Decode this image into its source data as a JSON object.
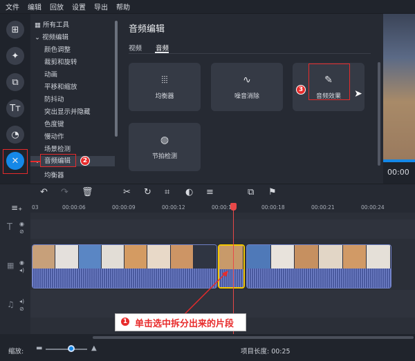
{
  "menu": [
    "文件",
    "编辑",
    "回放",
    "设置",
    "导出",
    "帮助"
  ],
  "tree": {
    "head": "所有工具",
    "group": "视频编辑",
    "items": [
      "颜色调整",
      "裁剪和旋转",
      "动画",
      "平移和缩放",
      "防抖动",
      "突出显示并隐藏",
      "色度键",
      "慢动作",
      "场景检测"
    ],
    "selected": "音频编辑",
    "after": "均衡器"
  },
  "panel": {
    "title": "音频编辑",
    "tabs": [
      "视频",
      "音频"
    ],
    "cards": [
      {
        "label": "均衡器",
        "icon": "equalizer-icon"
      },
      {
        "label": "噪音消除",
        "icon": "noise-removal-icon"
      },
      {
        "label": "音频效果",
        "icon": "audio-effects-icon"
      },
      {
        "label": "节拍检测",
        "icon": "beat-detection-icon"
      }
    ]
  },
  "preview": {
    "time": "00:00"
  },
  "ruler": [
    "03",
    "00:00:06",
    "00:00:09",
    "00:00:12",
    "00:00:1",
    "00:00:18",
    "00:00:21",
    "00:00:24"
  ],
  "status": {
    "zoom_label": "缩放:",
    "project_length": "项目长度: 00:25"
  },
  "annotations": {
    "a1": "单击选中拆分出来的片段",
    "n1": "1",
    "n2": "2",
    "n3": "3"
  },
  "colors": {
    "accent": "#1588e8",
    "annotation": "#e82b2b",
    "selection": "#f5c800"
  }
}
